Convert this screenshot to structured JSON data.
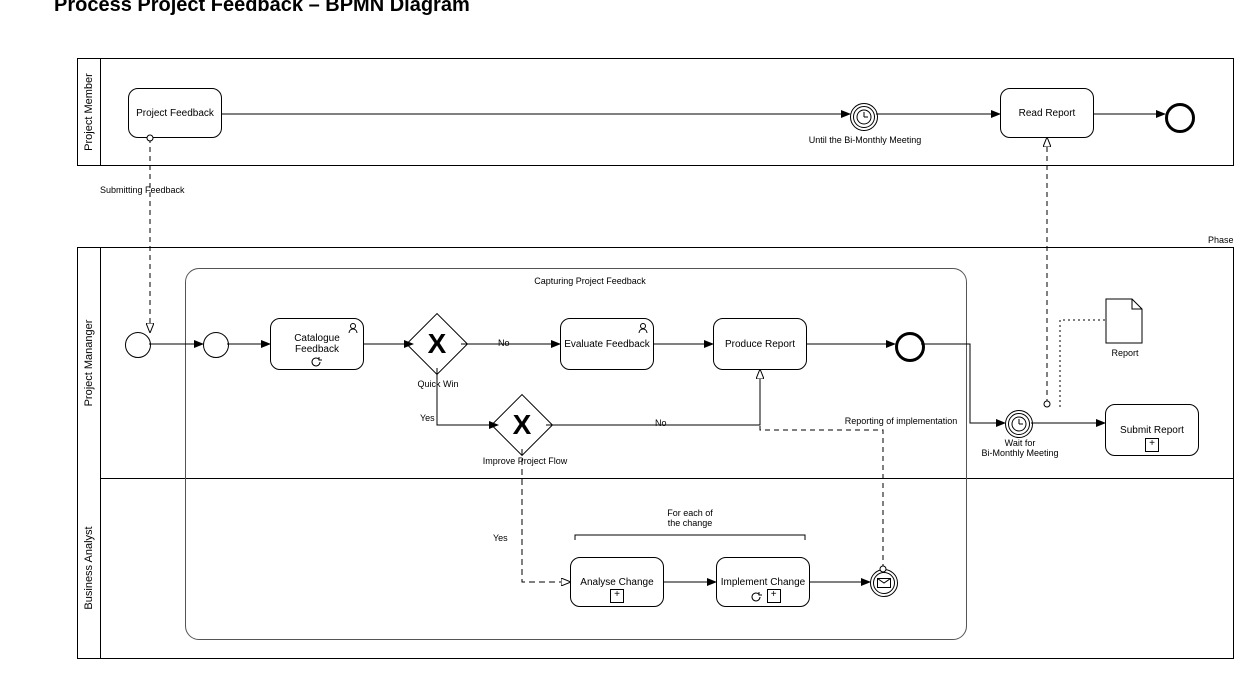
{
  "title": "Process Project Feedback – BPMN Diagram",
  "phase_label": "Phase",
  "pool1": {
    "lane": "Project Member",
    "task_feedback": "Project Feedback",
    "timer_label": "Until the Bi-Monthly Meeting",
    "task_read": "Read Report"
  },
  "msg_submit": "Submitting Feedback",
  "pool2": {
    "lane_pm": "Project Mananger",
    "lane_ba": "Business Analyst",
    "group_title": "Capturing Project Feedback",
    "task_catalogue": "Catalogue Feedback",
    "gateway1_label": "Quick Win",
    "gateway2_label": "Improve Project Flow",
    "edge_no1": "No",
    "edge_yes1": "Yes",
    "edge_no2": "No",
    "edge_yes2": "Yes",
    "task_evaluate": "Evaluate Feedback",
    "task_produce": "Produce Report",
    "msg_reporting": "Reporting of implementation",
    "foreach": "For each of\nthe change",
    "task_analyse": "Analyse Change",
    "task_implement": "Implement Change",
    "timer2_label": "Wait for\nBi-Monthly Meeting",
    "task_submit": "Submit Report",
    "artifact_report": "Report"
  }
}
